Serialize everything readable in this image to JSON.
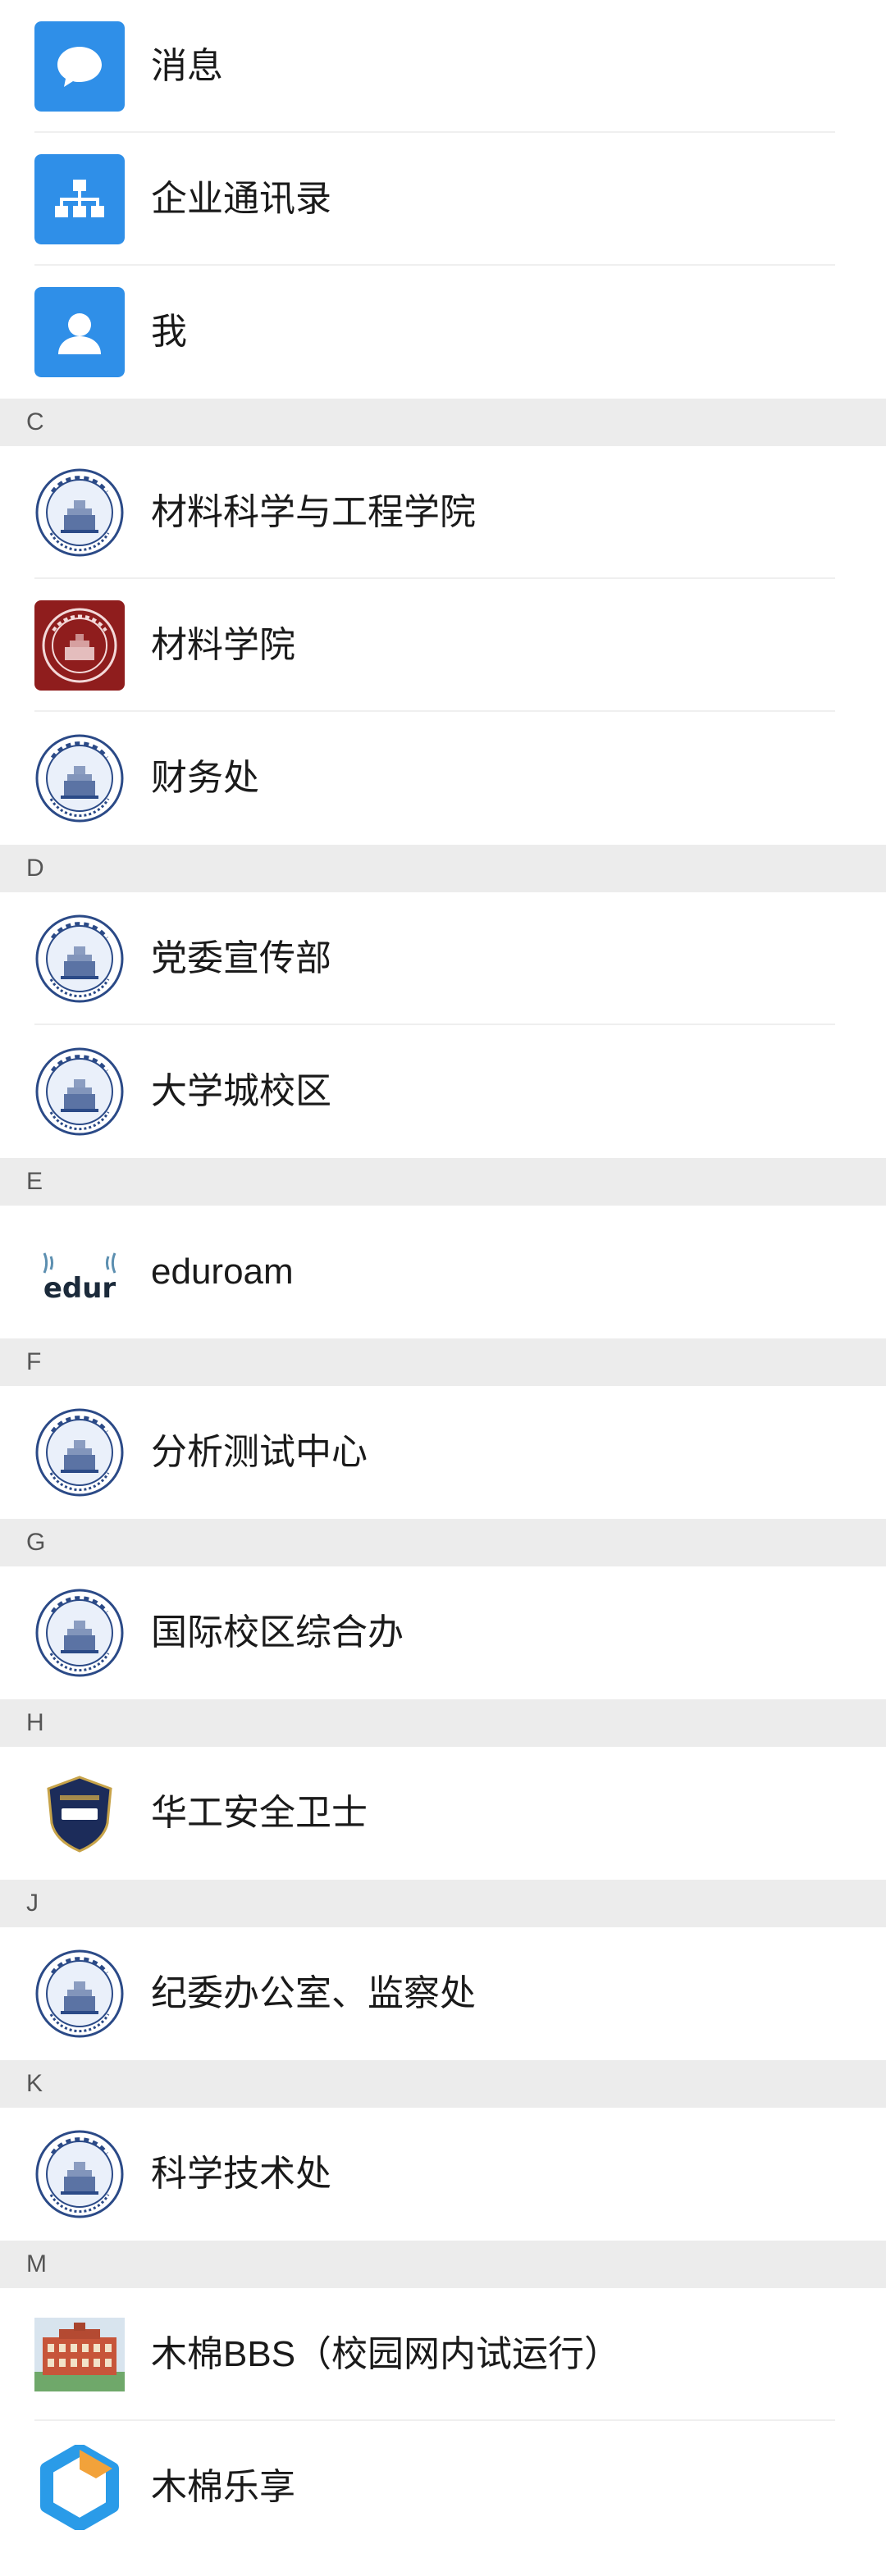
{
  "top_items": [
    {
      "label": "消息",
      "icon": "chat-bubble-icon"
    },
    {
      "label": "企业通讯录",
      "icon": "org-chart-icon"
    },
    {
      "label": "我",
      "icon": "person-icon"
    }
  ],
  "sections": [
    {
      "letter": "C",
      "items": [
        {
          "label": "材料科学与工程学院",
          "icon": "university-seal-icon"
        },
        {
          "label": "材料学院",
          "icon": "red-seal-icon"
        },
        {
          "label": "财务处",
          "icon": "university-seal-icon"
        }
      ]
    },
    {
      "letter": "D",
      "items": [
        {
          "label": "党委宣传部",
          "icon": "university-seal-icon"
        },
        {
          "label": "大学城校区",
          "icon": "university-seal-icon"
        }
      ]
    },
    {
      "letter": "E",
      "items": [
        {
          "label": "eduroam",
          "icon": "eduroam-logo-icon"
        }
      ]
    },
    {
      "letter": "F",
      "items": [
        {
          "label": "分析测试中心",
          "icon": "university-seal-icon"
        }
      ]
    },
    {
      "letter": "G",
      "items": [
        {
          "label": "国际校区综合办",
          "icon": "university-seal-icon"
        }
      ]
    },
    {
      "letter": "H",
      "items": [
        {
          "label": "华工安全卫士",
          "icon": "security-shield-icon"
        }
      ]
    },
    {
      "letter": "J",
      "items": [
        {
          "label": "纪委办公室、监察处",
          "icon": "university-seal-icon"
        }
      ]
    },
    {
      "letter": "K",
      "items": [
        {
          "label": "科学技术处",
          "icon": "university-seal-icon"
        }
      ]
    },
    {
      "letter": "M",
      "items": [
        {
          "label": "木棉BBS（校园网内试运行）",
          "icon": "campus-building-icon"
        },
        {
          "label": "木棉乐享",
          "icon": "hexagon-logo-icon"
        }
      ]
    }
  ],
  "colors": {
    "accent_blue": "#2f8fe8",
    "section_bg": "#ececec",
    "divider": "#efefef"
  }
}
